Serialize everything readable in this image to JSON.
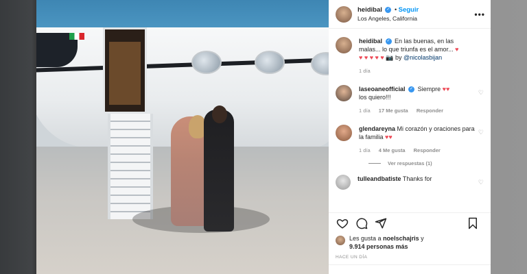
{
  "post": {
    "username": "heidibal",
    "follow_label": "Seguir",
    "separator": "•",
    "location": "Los Angeles, California",
    "more_label": "•••"
  },
  "caption": {
    "username": "heidibal",
    "text": "En las buenas, en las malas... lo que triunfa es el amor...",
    "hearts": "♥ ♥ ♥ ♥ ♥",
    "camera": "📷",
    "by_label": "by",
    "mention": "@nicolasbijan",
    "time": "1 día"
  },
  "comments": [
    {
      "username": "laseoaneofficial",
      "text": "Siempre",
      "emoji": "♥♥",
      "text2": "los quiero!!!",
      "time": "1 día",
      "likes": "17 Me gusta",
      "reply": "Responder"
    },
    {
      "username": "glendareyna",
      "text": "Mi corazón y oraciones para la familia",
      "emoji": "♥♥",
      "time": "1 día",
      "likes": "4 Me gusta",
      "reply": "Responder",
      "view_replies": "Ver respuestas (1)"
    },
    {
      "username": "tulleandbatiste",
      "text": "Thanks for"
    }
  ],
  "likes": {
    "line1_prefix": "Les gusta a",
    "line1_user": "noelschajris",
    "line1_suffix": "y",
    "line2": "9.914 personas más"
  },
  "time_ago": "HACE UN DÍA",
  "colors": {
    "accent": "#0095f6",
    "verified": "#3897f0",
    "heart": "#ed4956",
    "muted": "#8e8e8e"
  },
  "icons": {
    "like": "heart-outline-icon",
    "comment": "comment-bubble-icon",
    "share": "paper-plane-icon",
    "save": "bookmark-icon"
  }
}
